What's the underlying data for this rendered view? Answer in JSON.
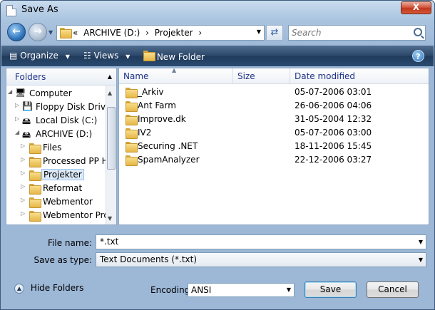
{
  "window": {
    "title": "Save As",
    "close_label": "X"
  },
  "address_bar": {
    "prefix": "«",
    "crumbs": [
      "ARCHIVE (D:)",
      "›",
      "Projekter",
      "›"
    ]
  },
  "search": {
    "placeholder": "Search"
  },
  "command_bar": {
    "organize": "Organize",
    "views": "Views",
    "new_folder": "New Folder",
    "help": "?"
  },
  "nav_pane": {
    "header": "Folders",
    "items": [
      {
        "label": "Computer",
        "icon": "computer-icon"
      },
      {
        "label": "Floppy Disk Drive",
        "icon": "floppy-icon"
      },
      {
        "label": "Local Disk (C:)",
        "icon": "drive-icon"
      },
      {
        "label": "ARCHIVE (D:)",
        "icon": "drive-icon"
      },
      {
        "label": "Files",
        "icon": "folder-icon"
      },
      {
        "label": "Processed PP HF",
        "icon": "folder-icon"
      },
      {
        "label": "Projekter",
        "icon": "folder-icon"
      },
      {
        "label": "Reformat",
        "icon": "folder-icon"
      },
      {
        "label": "Webmentor",
        "icon": "folder-icon"
      },
      {
        "label": "Webmentor Pro",
        "icon": "folder-icon"
      }
    ]
  },
  "file_list": {
    "columns": {
      "name": "Name",
      "size": "Size",
      "date": "Date modified"
    },
    "rows": [
      {
        "name": "_Arkiv",
        "date": "05-07-2006 03:01"
      },
      {
        "name": "Ant Farm",
        "date": "26-06-2006 04:06"
      },
      {
        "name": "Improve.dk",
        "date": "31-05-2004 12:32"
      },
      {
        "name": "IV2",
        "date": "05-07-2006 03:00"
      },
      {
        "name": "Securing .NET",
        "date": "18-11-2006 15:45"
      },
      {
        "name": "SpamAnalyzer",
        "date": "22-12-2006 03:27"
      }
    ]
  },
  "save_fields": {
    "file_name_label": "File name:",
    "file_name_value": "*.txt",
    "type_label": "Save as type:",
    "type_value": "Text Documents (*.txt)"
  },
  "footer": {
    "hide_folders": "Hide Folders",
    "encoding_label": "Encoding:",
    "encoding_value": "ANSI",
    "save": "Save",
    "cancel": "Cancel"
  }
}
